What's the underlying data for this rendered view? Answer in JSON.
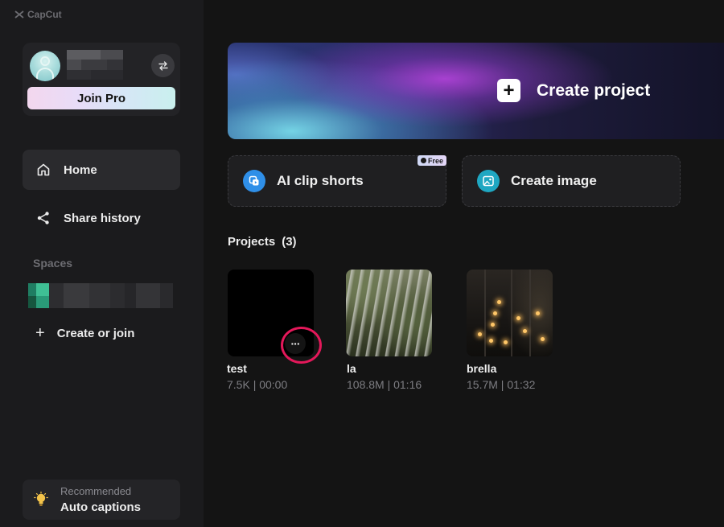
{
  "app": {
    "logo_text": "CapCut"
  },
  "profile": {
    "join_pro_label": "Join Pro"
  },
  "nav": {
    "home_label": "Home",
    "share_label": "Share history"
  },
  "spaces": {
    "label": "Spaces",
    "create_join_label": "Create or join",
    "plus": "+"
  },
  "recommend": {
    "small": "Recommended",
    "title": "Auto captions"
  },
  "hero": {
    "plus": "+",
    "label": "Create project"
  },
  "cards": {
    "ai_label": "AI clip shorts",
    "free_badge": "Free",
    "image_label": "Create image"
  },
  "projects": {
    "title": "Projects",
    "count": "(3)",
    "items": [
      {
        "name": "test",
        "meta": "7.5K | 00:00"
      },
      {
        "name": "la",
        "meta": "108.8M | 01:16"
      },
      {
        "name": "brella",
        "meta": "15.7M | 01:32"
      }
    ],
    "more_label": "···"
  },
  "colors": {
    "highlight": "#e3185a",
    "sidebar": "#1b1b1d",
    "background": "#141414"
  }
}
